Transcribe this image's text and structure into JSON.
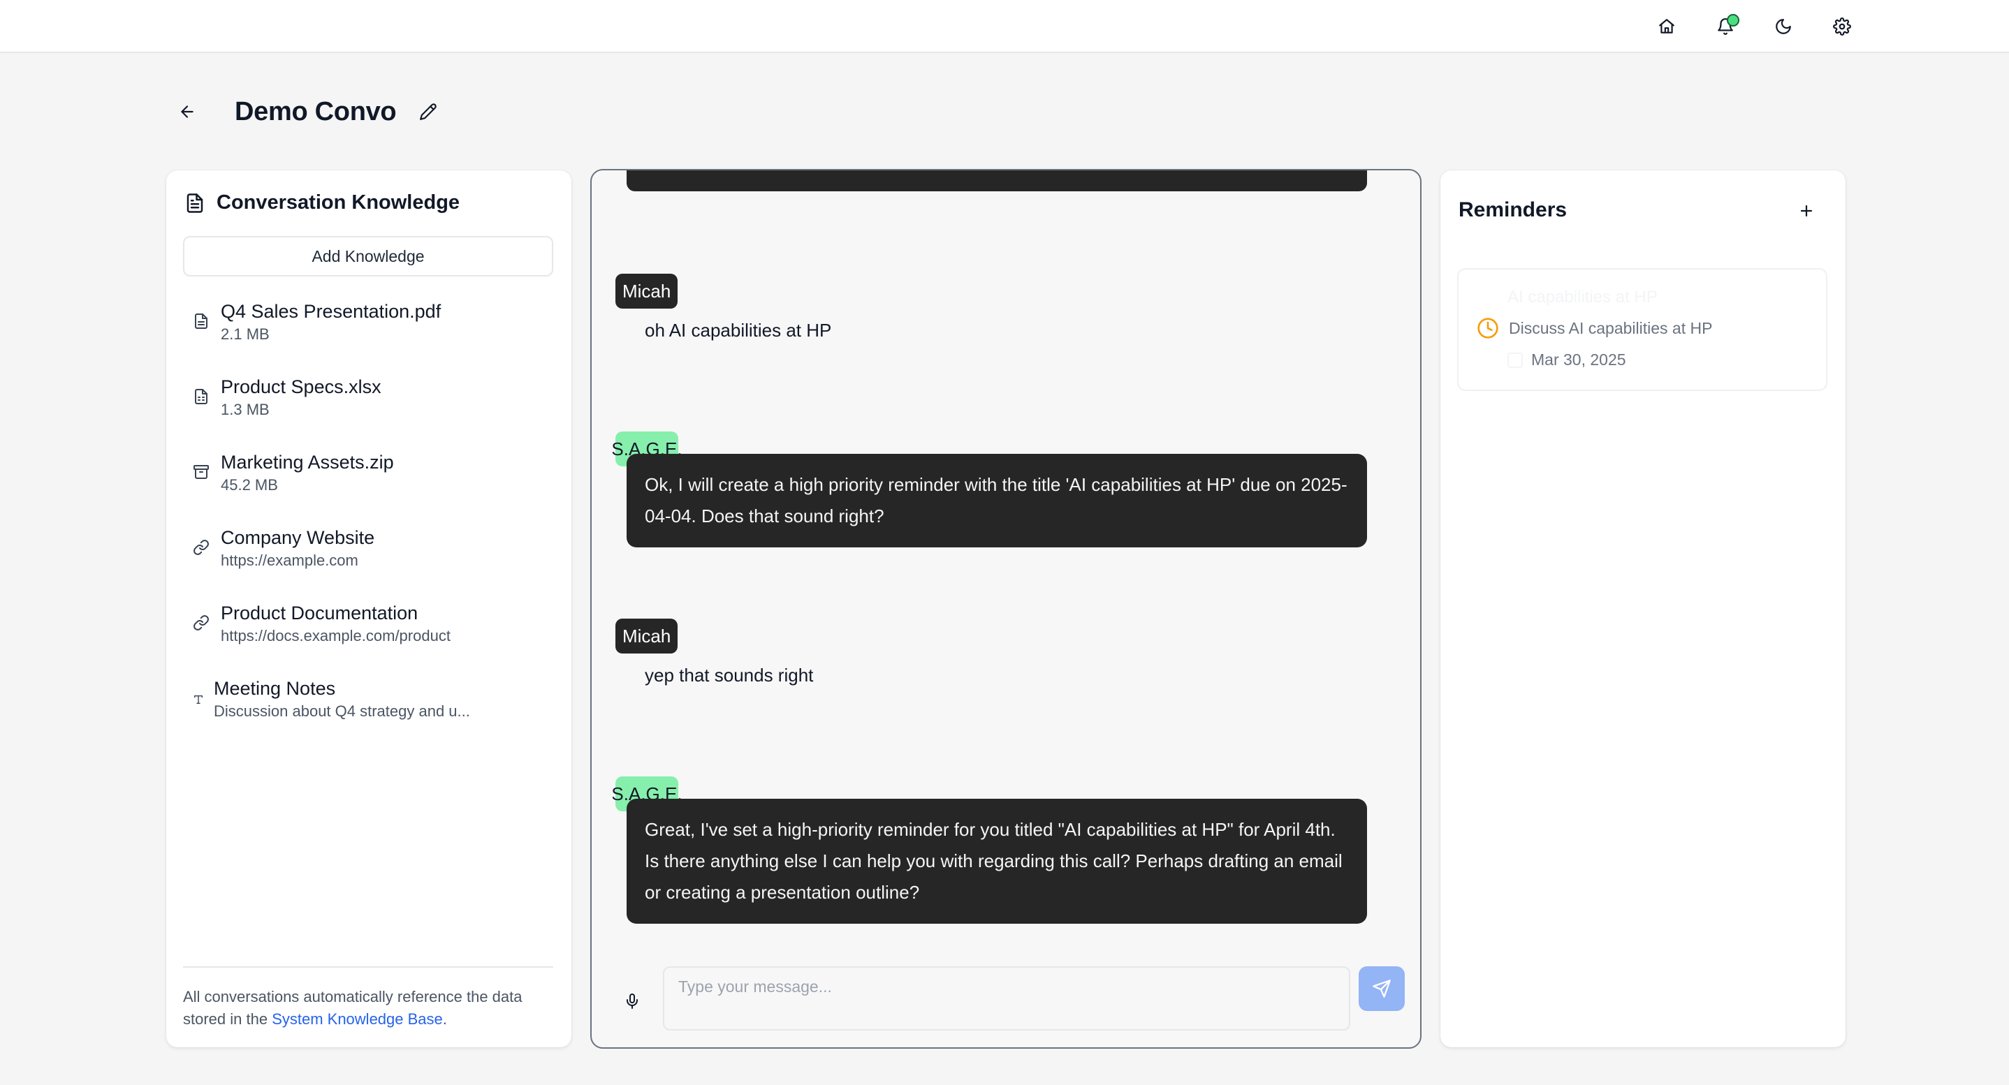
{
  "page": {
    "title": "Demo Convo"
  },
  "knowledge": {
    "title": "Conversation Knowledge",
    "add_button": "Add Knowledge",
    "items": [
      {
        "name": "Q4 Sales Presentation.pdf",
        "sub": "2.1 MB",
        "icon": "file-text-icon"
      },
      {
        "name": "Product Specs.xlsx",
        "sub": "1.3 MB",
        "icon": "spreadsheet-icon"
      },
      {
        "name": "Marketing Assets.zip",
        "sub": "45.2 MB",
        "icon": "archive-icon"
      },
      {
        "name": "Company Website",
        "sub": "https://example.com",
        "icon": "link-icon"
      },
      {
        "name": "Product Documentation",
        "sub": "https://docs.example.com/product",
        "icon": "link-icon"
      },
      {
        "name": "Meeting Notes",
        "sub": "Discussion about Q4 strategy and u...",
        "icon": "text-icon"
      }
    ],
    "footer_text": "All conversations automatically reference the data stored in the ",
    "footer_link": "System Knowledge Base",
    "footer_end": "."
  },
  "chat": {
    "messages": [
      {
        "sender": "Micah",
        "role": "user",
        "text": "oh AI capabilities at HP"
      },
      {
        "sender": "S.A.G.E.",
        "role": "bot",
        "text": "Ok, I will create a high priority reminder with the title 'AI capabilities at HP' due on 2025-04-04. Does that sound right?"
      },
      {
        "sender": "Micah",
        "role": "user",
        "text": "yep that sounds right"
      },
      {
        "sender": "S.A.G.E.",
        "role": "bot",
        "text": "Great, I've set a high-priority reminder for you titled \"AI capabilities at HP\" for April 4th. Is there anything else I can help you with regarding this call? Perhaps drafting an email or creating a presentation outline?"
      }
    ],
    "input_placeholder": "Type your message...",
    "input_value": ""
  },
  "reminders": {
    "title": "Reminders",
    "items": [
      {
        "title": "AI capabilities at HP",
        "description": "Discuss AI capabilities at HP",
        "date": "Mar 30, 2025"
      }
    ]
  },
  "colors": {
    "user_badge": "#262626",
    "bot_badge": "#86efac",
    "bot_bubble": "#262626",
    "send_button": "#93b4f5",
    "link": "#2563eb",
    "clock": "#f59e0b",
    "notification_dot": "#4ade80"
  },
  "icons": {
    "topbar": [
      "home-icon",
      "bell-icon",
      "moon-icon",
      "gear-icon"
    ]
  }
}
